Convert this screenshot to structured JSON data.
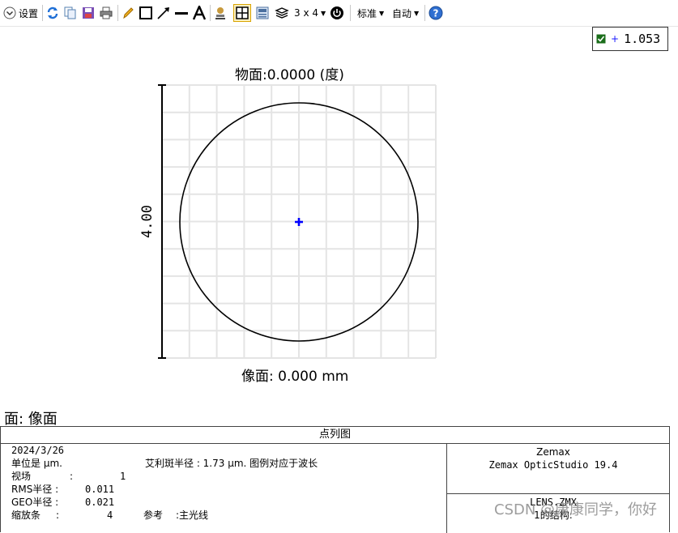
{
  "toolbar": {
    "settings_label": "设置",
    "layout_label": "3 x 4",
    "standard_label": "标准",
    "auto_label": "自动",
    "icons": [
      "chevron-down-icon",
      "refresh-icon",
      "copy-icon",
      "save-icon",
      "print-icon",
      "pencil-icon",
      "rectangle-icon",
      "arrow-icon",
      "line-icon",
      "text-icon",
      "stamp-icon",
      "grid-icon",
      "export-icon",
      "layers-icon",
      "power-icon",
      "help-icon"
    ]
  },
  "legend": {
    "value": "1.053",
    "marker_color": "#1a1aff",
    "check_color": "#1b6e1b"
  },
  "plot": {
    "title": "物面:0.0000 (度)",
    "x_label": "像面: 0.000 mm",
    "y_label": "4.00",
    "grid_cells": 10,
    "grid_color": "#e4e4e4",
    "circle_color": "#000000",
    "spot_color": "#0000ff"
  },
  "surface_label": "面: 像面",
  "panel": {
    "title": "点列图",
    "date": "2024/3/26",
    "units": "单位是 µm.",
    "airy": "艾利斑半径 : 1.73 µm. 图例对应于波长",
    "field_label": "视场",
    "field_sep": ":",
    "field_value": "1",
    "rms_label": "RMS半径 :",
    "rms_value": "0.011",
    "geo_label": "GEO半径 :",
    "geo_value": "0.021",
    "scale_label": "缩放条",
    "scale_sep": ":",
    "scale_value": "4",
    "ref_label": "参考",
    "ref_value": ":主光线",
    "company": "Zemax",
    "product": "Zemax OpticStudio 19.4",
    "lens": "LENS.ZMX",
    "config": "1的结构:"
  },
  "watermark": "CSDN @康康同学，你好"
}
